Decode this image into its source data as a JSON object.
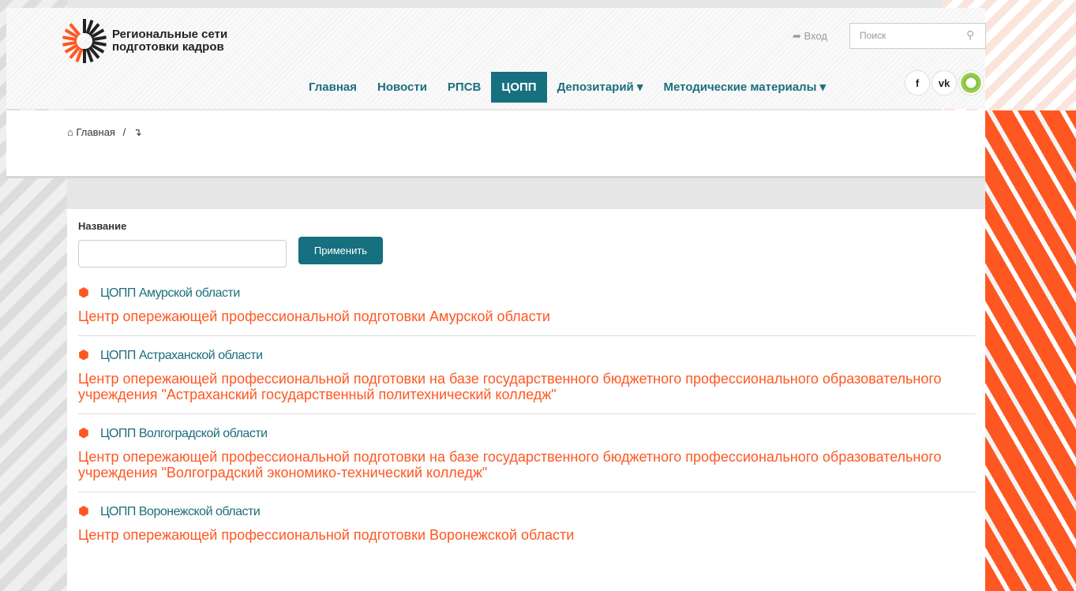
{
  "header": {
    "logo_line1": "Региональные сети",
    "logo_line2": "подготовки кадров",
    "login_label": "Вход",
    "search_placeholder": "Поиск"
  },
  "nav": {
    "items": [
      {
        "label": "Главная"
      },
      {
        "label": "Новости"
      },
      {
        "label": "РПСВ"
      },
      {
        "label": "ЦОПП"
      },
      {
        "label": "Депозитарий ▾"
      },
      {
        "label": "Методические материалы ▾"
      }
    ],
    "active_index": 3
  },
  "socials": [
    "f",
    "vk"
  ],
  "breadcrumb": {
    "home": "Главная",
    "separator": "/",
    "current": "↴"
  },
  "filter": {
    "label": "Название",
    "apply_label": "Применить"
  },
  "items": [
    {
      "title": "ЦОПП Амурской области",
      "desc": "Центр опережающей профессиональной подготовки Амурской области"
    },
    {
      "title": "ЦОПП Астраханской области",
      "desc": "Центр опережающей профессиональной подготовки на базе государственного бюджетного профессионального образовательного учреждения \"Астраханский государственный политехнический колледж\""
    },
    {
      "title": "ЦОПП Волгоградской области",
      "desc": "Центр опережающей профессиональной подготовки на базе государственного бюджетного профессионального образовательного учреждения \"Волгоградский экономико-технический колледж\""
    },
    {
      "title": "ЦОПП Воронежской области",
      "desc": "Центр опережающей профессиональной подготовки Воронежской области"
    }
  ],
  "colors": {
    "accent": "#17707f",
    "orange": "#ff5722"
  }
}
